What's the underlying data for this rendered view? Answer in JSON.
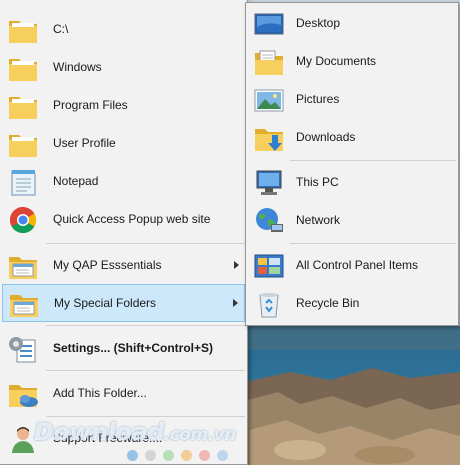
{
  "main_menu": {
    "items": [
      {
        "label": "C:\\",
        "icon": "folder-icon"
      },
      {
        "label": "Windows",
        "icon": "folder-icon"
      },
      {
        "label": "Program Files",
        "icon": "folder-icon"
      },
      {
        "label": "User Profile",
        "icon": "folder-icon"
      },
      {
        "label": "Notepad",
        "icon": "notepad-icon"
      },
      {
        "label": "Quick Access Popup web site",
        "icon": "chrome-icon"
      },
      {
        "label": "My QAP Esssentials",
        "icon": "folder-menu-icon"
      },
      {
        "label": "My Special Folders",
        "icon": "folder-menu-icon"
      },
      {
        "label": "Settings... (Shift+Control+S)",
        "icon": "settings-icon"
      },
      {
        "label": "Add This Folder...",
        "icon": "add-folder-icon"
      },
      {
        "label": "Support Freeware!...",
        "icon": "user-icon"
      }
    ]
  },
  "sub_menu": {
    "items": [
      {
        "label": "Desktop",
        "icon": "desktop-icon"
      },
      {
        "label": "My Documents",
        "icon": "documents-folder-icon"
      },
      {
        "label": "Pictures",
        "icon": "pictures-icon"
      },
      {
        "label": "Downloads",
        "icon": "downloads-folder-icon"
      },
      {
        "label": "This PC",
        "icon": "this-pc-icon"
      },
      {
        "label": "Network",
        "icon": "network-icon"
      },
      {
        "label": "All Control Panel Items",
        "icon": "control-panel-icon"
      },
      {
        "label": "Recycle Bin",
        "icon": "recycle-bin-icon"
      }
    ]
  },
  "watermark": {
    "text": "Download",
    "suffix": ".com.vn"
  },
  "colors": {
    "menu_bg": "#f2f2f2",
    "selected_bg": "#cde8fb",
    "selected_border": "#8fc4ea",
    "folder": "#f3c84b"
  }
}
